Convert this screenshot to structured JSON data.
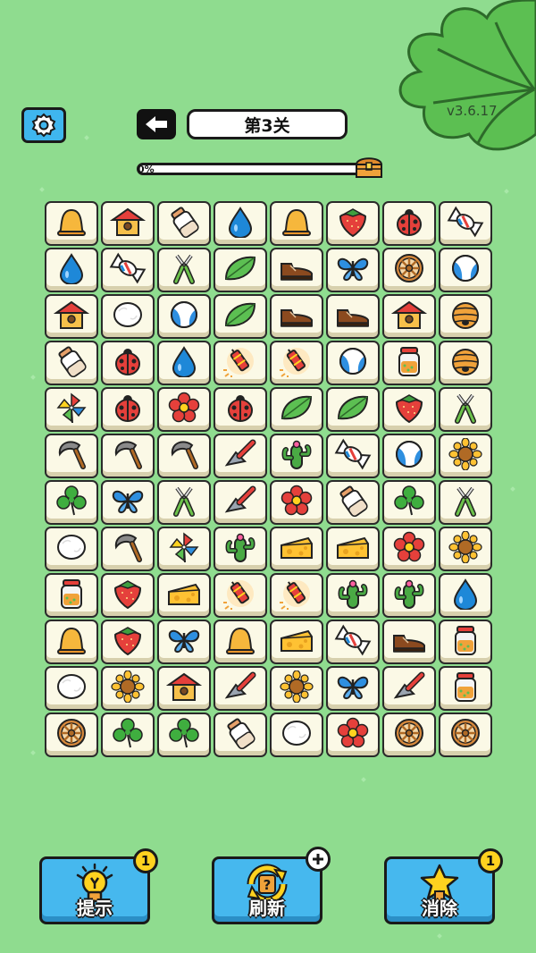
{
  "header": {
    "settings_icon": "gear-icon",
    "back_icon": "arrow-left-icon",
    "level_title": "第3关",
    "version": "v3.6.17"
  },
  "progress": {
    "label": "0%",
    "value": 0,
    "reward_icon": "treasure-chest-icon"
  },
  "board": {
    "columns": 8,
    "rows": [
      [
        "bell",
        "birdhouse",
        "milk-bottle",
        "water-drop",
        "bell",
        "strawberry",
        "ladybug",
        "candy"
      ],
      [
        "water-drop",
        "candy",
        "pliers",
        "leaf",
        "shoe",
        "butterfly",
        "wheel",
        "beach-ball"
      ],
      [
        "birdhouse",
        "cotton-ball",
        "beach-ball",
        "leaf",
        "shoe",
        "shoe",
        "birdhouse",
        "beehive"
      ],
      [
        "milk-bottle",
        "ladybug",
        "water-drop",
        "firecracker",
        "firecracker",
        "beach-ball",
        "jar",
        "beehive"
      ],
      [
        "pinwheel",
        "ladybug",
        "flower",
        "ladybug",
        "leaf",
        "leaf",
        "strawberry",
        "pliers"
      ],
      [
        "sickle",
        "sickle",
        "sickle",
        "scraper",
        "cactus",
        "candy",
        "beach-ball",
        "sunflower"
      ],
      [
        "clover",
        "butterfly",
        "pliers",
        "scraper",
        "flower",
        "milk-bottle",
        "clover",
        "pliers"
      ],
      [
        "cotton-ball",
        "sickle",
        "pinwheel",
        "cactus",
        "cheese",
        "cheese",
        "flower",
        "sunflower"
      ],
      [
        "jar",
        "strawberry",
        "cheese",
        "firecracker",
        "firecracker",
        "cactus",
        "cactus",
        "water-drop"
      ],
      [
        "bell",
        "strawberry",
        "butterfly",
        "bell",
        "cheese",
        "candy",
        "shoe",
        "jar"
      ],
      [
        "cotton-ball",
        "sunflower",
        "birdhouse",
        "scraper",
        "sunflower",
        "butterfly",
        "scraper",
        "jar"
      ],
      [
        "wheel",
        "clover",
        "clover",
        "milk-bottle",
        "cotton-ball",
        "flower",
        "wheel",
        "wheel"
      ]
    ]
  },
  "actions": [
    {
      "label": "提示",
      "icon": "lightbulb-icon",
      "badge": "1"
    },
    {
      "label": "刷新",
      "icon": "refresh-icon",
      "badge": "+"
    },
    {
      "label": "消除",
      "icon": "star-icon",
      "badge": "1"
    }
  ],
  "colors": {
    "background": "#8fdc8f",
    "button": "#46b8ee",
    "badge": "#ffd21f"
  }
}
